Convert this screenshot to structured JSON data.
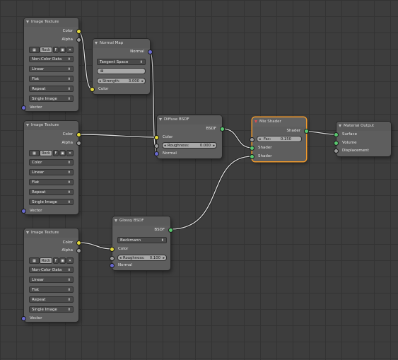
{
  "colors": {
    "background": "#3d3d3d",
    "node_body": "#5e5e5e",
    "active_outline": "#f09a2c",
    "link": "#dcdcdc",
    "socket_color": "#e3d93c",
    "socket_float": "#9b9b9b",
    "socket_vector": "#6969d0",
    "socket_shader": "#5ac870"
  },
  "nodes": {
    "image_texture_1": {
      "title": "Image Texture",
      "out_color": "Color",
      "out_alpha": "Alpha",
      "image_name": "Rock",
      "fake_user": "F",
      "color_space": "Non-Color Data",
      "interpolation": "Linear",
      "projection": "Flat",
      "extension": "Repeat",
      "source": "Single Image",
      "in_vector": "Vector"
    },
    "normal_map": {
      "title": "Normal Map",
      "out_normal": "Normal",
      "space": "Tangent Space",
      "strength_label": "Strength:",
      "strength_value": "3.000",
      "in_color": "Color"
    },
    "image_texture_2": {
      "title": "Image Texture",
      "out_color": "Color",
      "out_alpha": "Alpha",
      "image_name": "Rock",
      "fake_user": "F",
      "color_space": "Color",
      "interpolation": "Linear",
      "projection": "Flat",
      "extension": "Repeat",
      "source": "Single Image",
      "in_vector": "Vector"
    },
    "diffuse_bsdf": {
      "title": "Diffuse BSDF",
      "out_bsdf": "BSDF",
      "in_color": "Color",
      "roughness_label": "Roughness:",
      "roughness_value": "0.000",
      "in_normal": "Normal"
    },
    "mix_shader": {
      "title": "Mix Shader",
      "out_shader": "Shader",
      "fac_label": "Fac:",
      "fac_value": "0.150",
      "in_shader_1": "Shader",
      "in_shader_2": "Shader"
    },
    "material_output": {
      "title": "Material Output",
      "in_surface": "Surface",
      "in_volume": "Volume",
      "in_displacement": "Displacement"
    },
    "image_texture_3": {
      "title": "Image Texture",
      "out_color": "Color",
      "out_alpha": "Alpha",
      "image_name": "Rock",
      "fake_user": "F",
      "color_space": "Non-Color Data",
      "interpolation": "Linear",
      "projection": "Flat",
      "extension": "Repeat",
      "source": "Single Image",
      "in_vector": "Vector"
    },
    "glossy_bsdf": {
      "title": "Glossy BSDF",
      "out_bsdf": "BSDF",
      "distribution": "Beckmann",
      "in_color": "Color",
      "roughness_label": "Roughness:",
      "roughness_value": "0.100",
      "in_normal": "Normal"
    }
  }
}
